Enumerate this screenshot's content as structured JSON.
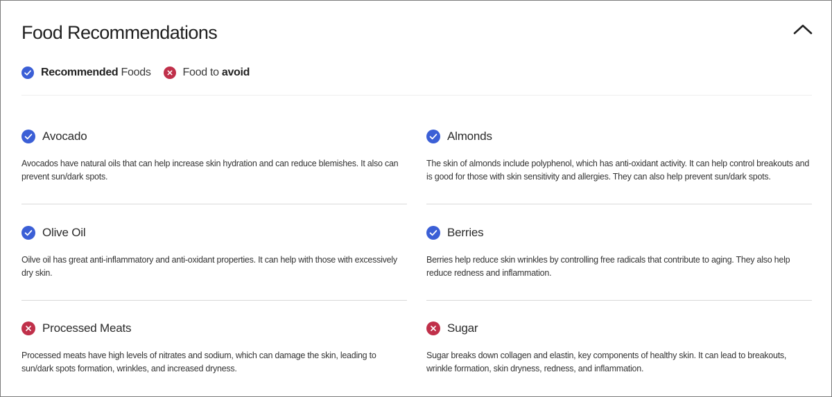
{
  "header": {
    "title": "Food Recommendations",
    "collapse_icon": "chevron-up-icon"
  },
  "legend": {
    "recommended_bold": "Recommended",
    "recommended_rest": " Foods",
    "avoid_rest": "Food to ",
    "avoid_bold": "avoid"
  },
  "colors": {
    "recommended": "#3b5fd6",
    "avoid": "#c0304a"
  },
  "foods": [
    {
      "name": "Avocado",
      "status": "recommended",
      "icon": "check-circle-icon",
      "description": "Avocados have natural oils that can help increase skin hydration and can reduce blemishes. It also can prevent sun/dark spots."
    },
    {
      "name": "Almonds",
      "status": "recommended",
      "icon": "check-circle-icon",
      "description": "The skin of almonds include polyphenol, which has anti-oxidant activity. It can help control breakouts and is good for those with skin sensitivity and allergies. They can also help prevent sun/dark spots."
    },
    {
      "name": "Olive Oil",
      "status": "recommended",
      "icon": "check-circle-icon",
      "description": "Oilve oil has great anti-inflammatory and anti-oxidant properties. It can help with those with excessively dry skin."
    },
    {
      "name": "Berries",
      "status": "recommended",
      "icon": "check-circle-icon",
      "description": "Berries help reduce skin wrinkles by controlling free radicals that contribute to aging. They also help reduce redness and inflammation."
    },
    {
      "name": "Processed Meats",
      "status": "avoid",
      "icon": "x-circle-icon",
      "description": "Processed meats have high levels of nitrates and sodium, which can damage the skin, leading to sun/dark spots formation, wrinkles, and increased dryness."
    },
    {
      "name": "Sugar",
      "status": "avoid",
      "icon": "x-circle-icon",
      "description": "Sugar breaks down collagen and elastin, key components of healthy skin. It can lead to breakouts, wrinkle formation, skin dryness, redness, and inflammation."
    }
  ]
}
